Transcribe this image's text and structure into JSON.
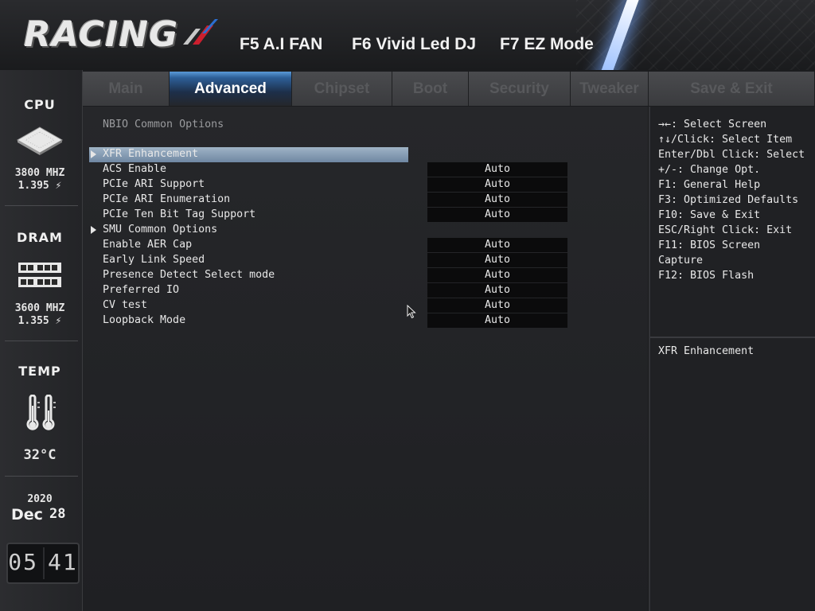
{
  "header": {
    "logo_text": "RACING",
    "hotkeys": [
      "F5 A.I FAN",
      "F6 Vivid Led DJ",
      "F7 EZ Mode"
    ]
  },
  "sidebar": {
    "cpu": {
      "label": "CPU",
      "freq": "3800 MHZ",
      "volt": "1.395 ⚡"
    },
    "dram": {
      "label": "DRAM",
      "freq": "3600 MHZ",
      "volt": "1.355 ⚡"
    },
    "temp": {
      "label": "TEMP",
      "value": "32°C"
    },
    "date": {
      "year": "2020",
      "month": "Dec",
      "day": "28"
    },
    "time": {
      "hours": "05",
      "minutes": "41"
    }
  },
  "tabs": [
    {
      "label": "Main",
      "active": false
    },
    {
      "label": "Advanced",
      "active": true
    },
    {
      "label": "Chipset",
      "active": false
    },
    {
      "label": "Boot",
      "active": false
    },
    {
      "label": "Security",
      "active": false
    },
    {
      "label": "Tweaker",
      "active": false
    },
    {
      "label": "Save & Exit",
      "active": false
    }
  ],
  "main": {
    "section_title": "NBIO Common Options",
    "rows": [
      {
        "label": "XFR Enhancement",
        "value": "",
        "submenu": true,
        "selected": true
      },
      {
        "label": "ACS Enable",
        "value": "Auto"
      },
      {
        "label": "PCIe ARI Support",
        "value": "Auto"
      },
      {
        "label": "PCIe ARI Enumeration",
        "value": "Auto"
      },
      {
        "label": "PCIe Ten Bit Tag Support",
        "value": "Auto"
      },
      {
        "label": "SMU Common Options",
        "value": "",
        "submenu": true
      },
      {
        "label": "Enable AER Cap",
        "value": "Auto"
      },
      {
        "label": "Early Link Speed",
        "value": "Auto"
      },
      {
        "label": "Presence Detect Select mode",
        "value": "Auto"
      },
      {
        "label": "Preferred IO",
        "value": "Auto"
      },
      {
        "label": "CV test",
        "value": "Auto"
      },
      {
        "label": "Loopback Mode",
        "value": "Auto"
      }
    ]
  },
  "help": {
    "keys": [
      "→←: Select Screen",
      "↑↓/Click: Select Item",
      "Enter/Dbl Click: Select",
      "+/-: Change Opt.",
      "F1: General Help",
      "F3: Optimized Defaults",
      "F10: Save & Exit",
      "ESC/Right Click: Exit",
      "F11: BIOS Screen",
      "Capture",
      "F12: BIOS Flash"
    ],
    "description": "XFR Enhancement"
  }
}
